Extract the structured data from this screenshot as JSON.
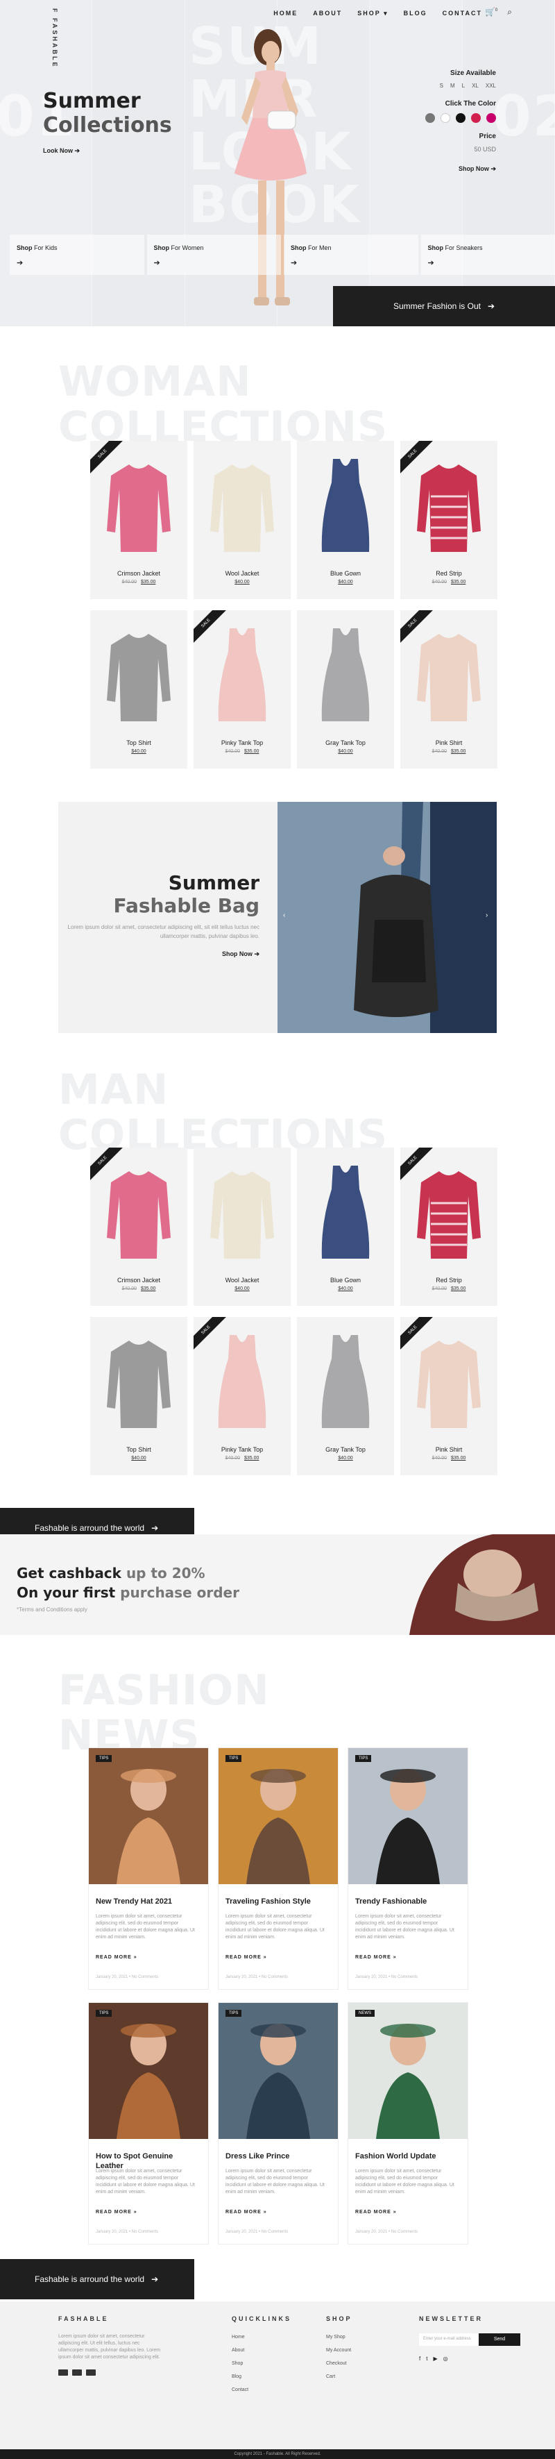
{
  "brand": {
    "name": "FASHABLE",
    "mark": "F"
  },
  "nav": {
    "items": [
      "HOME",
      "ABOUT",
      "SHOP ▾",
      "BLOG",
      "CONTACT"
    ],
    "cart_count": "0"
  },
  "hero": {
    "ghost_left": "01",
    "ghost_right": "02",
    "ghost_words": [
      "SUM",
      "MER",
      "LOOK",
      "BOOK"
    ],
    "title_1": "Summer",
    "title_2": "Collections",
    "link": "Look Now",
    "size_label": "Size Available",
    "sizes": [
      "S",
      "M",
      "L",
      "XL",
      "XXL"
    ],
    "color_label": "Click The Color",
    "colors": [
      "#777777",
      "#ffffff",
      "#111111",
      "#d11f4e",
      "#c8006b"
    ],
    "price_label": "Price",
    "price_value": "50 USD",
    "shop_now": "Shop Now",
    "shop_bar": [
      {
        "bold": "Shop",
        "label": "For Kids"
      },
      {
        "bold": "Shop",
        "label": "For Women"
      },
      {
        "bold": "Shop",
        "label": "For Men"
      },
      {
        "bold": "Shop",
        "label": "For Sneakers"
      }
    ],
    "cta": "Summer Fashion is Out"
  },
  "woman": {
    "ghost_1": "WOMAN",
    "ghost_2": "COLLECTIONS",
    "products": [
      {
        "name": "Crimson Jacket",
        "old": "$40.00",
        "now": "$35.00",
        "ribbon": "SALE"
      },
      {
        "name": "Wool Jacket",
        "old": "",
        "now": "$40.00",
        "ribbon": ""
      },
      {
        "name": "Blue Gown",
        "old": "",
        "now": "$40.00",
        "ribbon": ""
      },
      {
        "name": "Red Strip",
        "old": "$40.00",
        "now": "$35.00",
        "ribbon": "SALE"
      },
      {
        "name": "Top Shirt",
        "old": "",
        "now": "$40.00",
        "ribbon": ""
      },
      {
        "name": "Pinky Tank Top",
        "old": "$40.00",
        "now": "$35.00",
        "ribbon": "SALE"
      },
      {
        "name": "Gray Tank Top",
        "old": "",
        "now": "$40.00",
        "ribbon": ""
      },
      {
        "name": "Pink Shirt",
        "old": "$40.00",
        "now": "$35.00",
        "ribbon": "SALE"
      }
    ]
  },
  "bag": {
    "title_1": "Summer",
    "title_2": "Fashable Bag",
    "desc": "Lorem ipsum dolor sit amet, consectetur adipiscing elit, sit elit tellus luctus nec ullamcorper mattis, pulvinar dapibus leo.",
    "link": "Shop Now"
  },
  "man": {
    "ghost_1": "MAN",
    "ghost_2": "COLLECTIONS",
    "products": [
      {
        "name": "Crimson Jacket",
        "old": "$40.00",
        "now": "$35.00",
        "ribbon": "SALE"
      },
      {
        "name": "Wool Jacket",
        "old": "",
        "now": "$40.00",
        "ribbon": ""
      },
      {
        "name": "Blue Gown",
        "old": "",
        "now": "$40.00",
        "ribbon": ""
      },
      {
        "name": "Red Strip",
        "old": "$40.00",
        "now": "$35.00",
        "ribbon": "SALE"
      },
      {
        "name": "Top Shirt",
        "old": "",
        "now": "$40.00",
        "ribbon": ""
      },
      {
        "name": "Pinky Tank Top",
        "old": "$40.00",
        "now": "$35.00",
        "ribbon": "SALE"
      },
      {
        "name": "Gray Tank Top",
        "old": "",
        "now": "$40.00",
        "ribbon": ""
      },
      {
        "name": "Pink Shirt",
        "old": "$40.00",
        "now": "$35.00",
        "ribbon": "SALE"
      }
    ]
  },
  "around": "Fashable is arround the world",
  "cashback": {
    "l1_bold": "Get cashback",
    "l1_light": "up to 20%",
    "l2_bold": "On your first",
    "l2_light": "purchase order",
    "note": "*Terms and Conditions apply"
  },
  "news": {
    "ghost_1": "FASHION",
    "ghost_2": "NEWS",
    "items": [
      {
        "tag": "TIPS",
        "title": "New Trendy Hat 2021",
        "body": "Lorem ipsum dolor sit amet, consectetur adipiscing elit, sed do eiusmod tempor incididunt ut labore et dolore magna aliqua. Ut enim ad minim veniam.",
        "more": "READ MORE »",
        "meta": "January 20, 2021 • No Comments"
      },
      {
        "tag": "TIPS",
        "title": "Traveling Fashion Style",
        "body": "Lorem ipsum dolor sit amet, consectetur adipiscing elit, sed do eiusmod tempor incididunt ut labore et dolore magna aliqua. Ut enim ad minim veniam.",
        "more": "READ MORE »",
        "meta": "January 20, 2021 • No Comments"
      },
      {
        "tag": "TIPS",
        "title": "Trendy Fashionable",
        "body": "Lorem ipsum dolor sit amet, consectetur adipiscing elit, sed do eiusmod tempor incididunt ut labore et dolore magna aliqua. Ut enim ad minim veniam.",
        "more": "READ MORE »",
        "meta": "January 20, 2021 • No Comments"
      },
      {
        "tag": "TIPS",
        "title": "How to Spot Genuine Leather",
        "body": "Lorem ipsum dolor sit amet, consectetur adipiscing elit, sed do eiusmod tempor incididunt ut labore et dolore magna aliqua. Ut enim ad minim veniam.",
        "more": "READ MORE »",
        "meta": "January 20, 2021 • No Comments"
      },
      {
        "tag": "TIPS",
        "title": "Dress Like Prince",
        "body": "Lorem ipsum dolor sit amet, consectetur adipiscing elit, sed do eiusmod tempor incididunt ut labore et dolore magna aliqua. Ut enim ad minim veniam.",
        "more": "READ MORE »",
        "meta": "January 20, 2021 • No Comments"
      },
      {
        "tag": "NEWS",
        "title": "Fashion World Update",
        "body": "Lorem ipsum dolor sit amet, consectetur adipiscing elit, sed do eiusmod tempor incididunt ut labore et dolore magna aliqua. Ut enim ad minim veniam.",
        "more": "READ MORE »",
        "meta": "January 20, 2021 • No Comments"
      }
    ]
  },
  "footer": {
    "brand": "FASHABLE",
    "about": "Lorem ipsum dolor sit amet, consectetur adipiscing elit. Ut elit tellus, luctus nec ullamcorper mattis, pulvinar dapibus leo. Lorem ipsum dolor sit amet consectetur adipiscing elit.",
    "quick_h": "QUICKLINKS",
    "quick": [
      "Home",
      "About",
      "Shop",
      "Blog",
      "Contact"
    ],
    "shop_h": "SHOP",
    "shop": [
      "My Shop",
      "My Account",
      "Checkout",
      "Cart"
    ],
    "nl_h": "NEWSLETTER",
    "nl_placeholder": "Enter your e-mail address",
    "nl_btn": "Send",
    "social": [
      "f",
      "t",
      "▶",
      "◎"
    ]
  },
  "copyright": "Copyright 2021 - Fashable. All Right Reserved."
}
